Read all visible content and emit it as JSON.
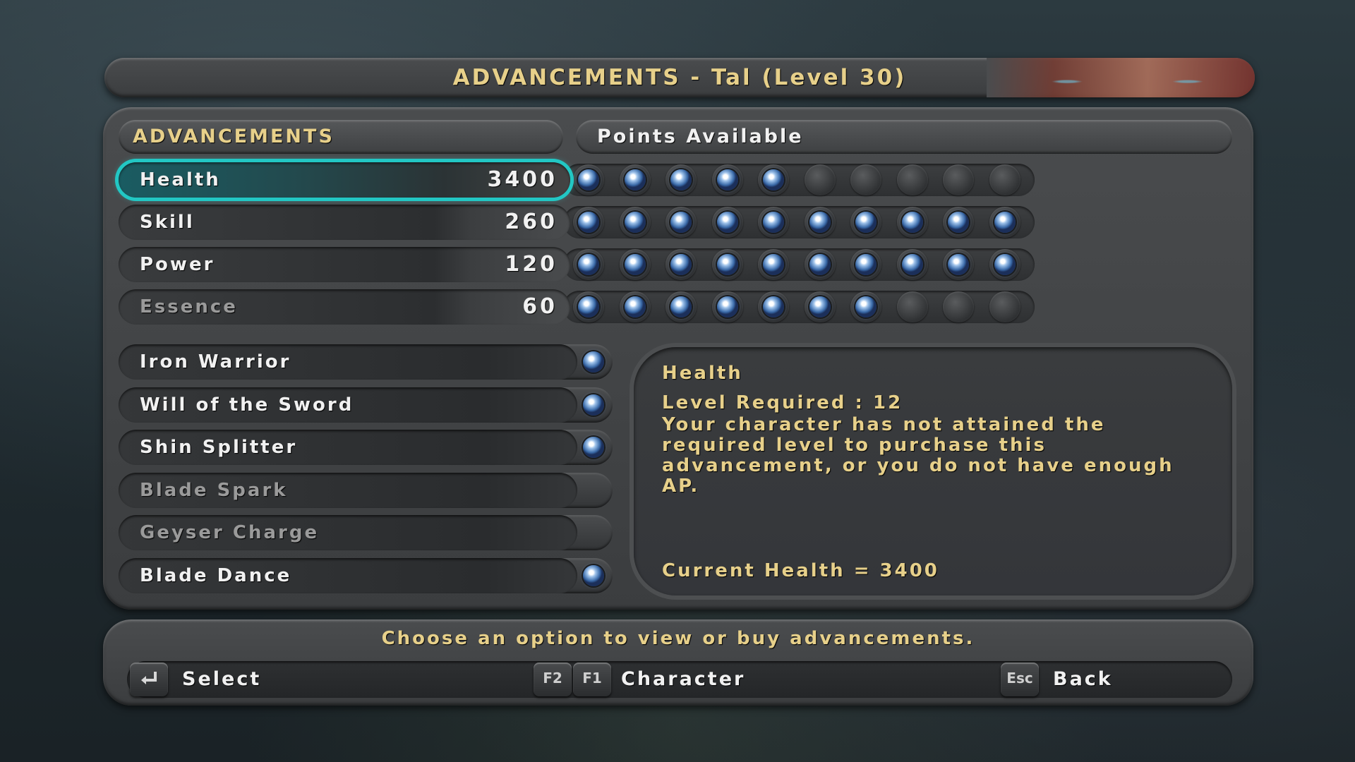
{
  "title": "ADVANCEMENTS - Tal (Level 30)",
  "headers": {
    "advancements": "ADVANCEMENTS",
    "points_available": "Points Available"
  },
  "stats": [
    {
      "name": "Health",
      "value": "3400",
      "filled": 5,
      "slots": 10,
      "selected": true,
      "dim": false
    },
    {
      "name": "Skill",
      "value": "260",
      "filled": 10,
      "slots": 10,
      "selected": false,
      "dim": false
    },
    {
      "name": "Power",
      "value": "120",
      "filled": 10,
      "slots": 10,
      "selected": false,
      "dim": false
    },
    {
      "name": "Essence",
      "value": "60",
      "filled": 7,
      "slots": 10,
      "selected": false,
      "dim": true
    }
  ],
  "abilities": [
    {
      "name": "Iron Warrior",
      "owned": true,
      "dim": false
    },
    {
      "name": "Will of the Sword",
      "owned": true,
      "dim": false
    },
    {
      "name": "Shin Splitter",
      "owned": true,
      "dim": false
    },
    {
      "name": "Blade Spark",
      "owned": false,
      "dim": true
    },
    {
      "name": "Geyser Charge",
      "owned": false,
      "dim": true
    },
    {
      "name": "Blade Dance",
      "owned": true,
      "dim": false
    }
  ],
  "description": {
    "title": "Health",
    "level_required": "Level Required : 12",
    "body": "Your character has not attained the required level to purchase this advancement, or you do not have enough AP.",
    "current": "Current Health = 3400"
  },
  "footer": {
    "instruction": "Choose an option to view or buy advancements.",
    "select_key_icon": "enter-key-icon",
    "select_label": "Select",
    "f2_key": "F2",
    "f1_key": "F1",
    "character_label": "Character",
    "esc_key": "Esc",
    "back_label": "Back"
  },
  "colors": {
    "accent_gold": "#e7d08a",
    "selection_cyan": "#22c7c4",
    "orb_blue": "#3a6aa8"
  }
}
